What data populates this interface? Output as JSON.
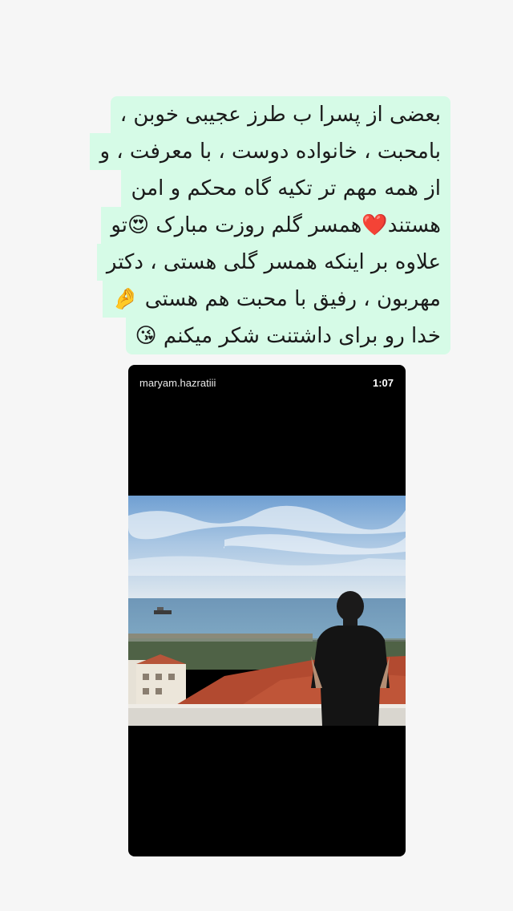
{
  "caption": {
    "lines": [
      {
        "text": "بعضی از پسرا ب طرز عجیبی خوبن ،",
        "emoji": ""
      },
      {
        "text": "بامحبت ، خانواده دوست ، با معرفت ، و",
        "emoji": ""
      },
      {
        "text": "از همه مهم تر تکیه گاه محکم و امن",
        "emoji": ""
      },
      {
        "text": "هستند❤️همسر گلم روزت مبارک 😍تو",
        "emoji": ""
      },
      {
        "text": "علاوه بر اینکه همسر گلی هستی ، دکتر",
        "emoji": ""
      },
      {
        "text": "مهربون ، رفیق با محبت  هم هستی 🤌",
        "emoji": ""
      },
      {
        "text": "خدا رو برای داشتنت شکر میکنم 😘",
        "emoji": ""
      }
    ],
    "background": "#d6fbe7"
  },
  "story": {
    "username": "maryam.hazratiii",
    "time": "1:07",
    "background": "#000000"
  }
}
